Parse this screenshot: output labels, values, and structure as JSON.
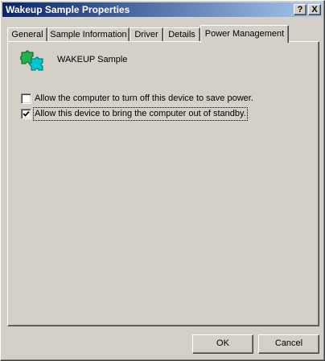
{
  "window": {
    "title": "Wakeup Sample Properties",
    "help_button": "?",
    "close_button": "X"
  },
  "tabs": [
    {
      "label": "General"
    },
    {
      "label": "Sample Information"
    },
    {
      "label": "Driver"
    },
    {
      "label": "Details"
    },
    {
      "label": "Power Management",
      "active": true
    }
  ],
  "device": {
    "name": "WAKEUP Sample",
    "icon": "puzzle-pieces-icon"
  },
  "options": [
    {
      "label": "Allow the computer to turn off this device to save power.",
      "checked": false
    },
    {
      "label": "Allow this device to bring the computer out of standby.",
      "checked": true
    }
  ],
  "buttons": {
    "ok": "OK",
    "cancel": "Cancel"
  },
  "colors": {
    "title_start": "#0a246a",
    "title_end": "#a6caf0",
    "face": "#d4d0c8",
    "icon_green": "#22b14c",
    "icon_cyan": "#00c8d0"
  }
}
